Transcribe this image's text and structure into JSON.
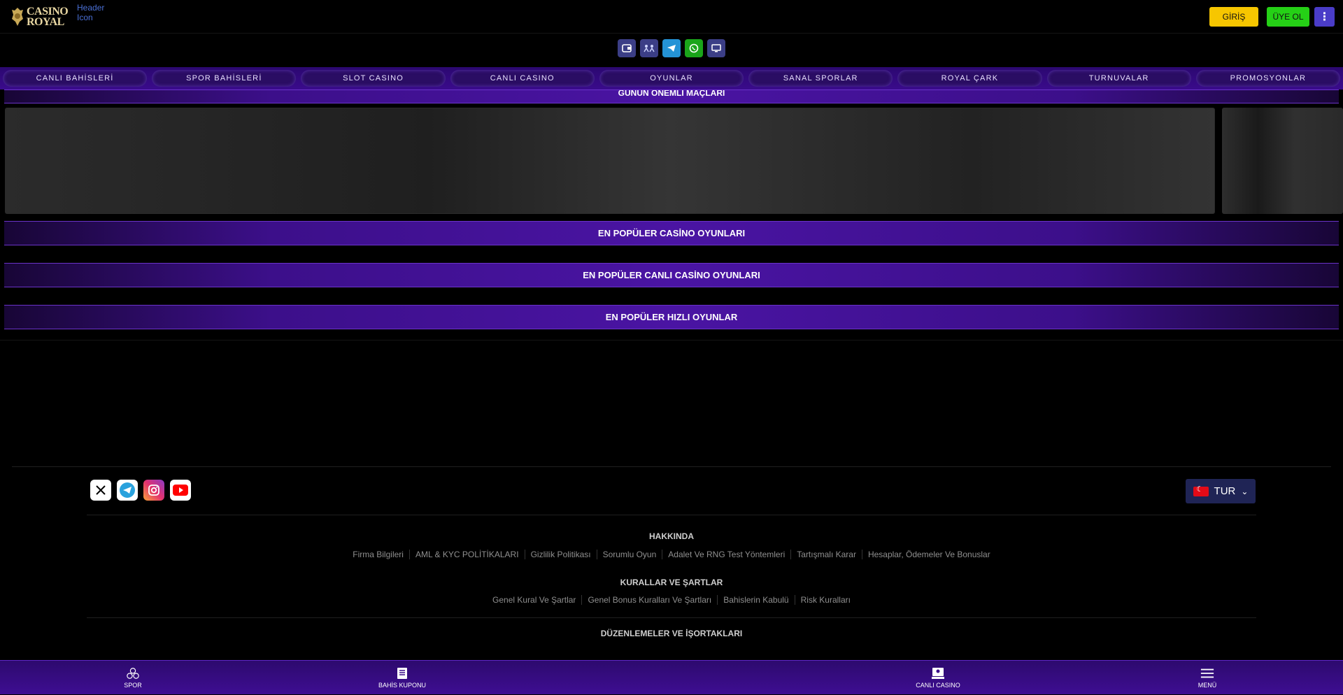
{
  "header": {
    "logo_line1": "CASINO",
    "logo_line2": "ROYAL",
    "broken_image_alt": "Header Icon",
    "login_label": "GİRİŞ",
    "register_label": "ÜYE OL",
    "more_icon": "kebab-menu-icon"
  },
  "quickbar": {
    "icons": [
      "wallet-icon",
      "users-icon",
      "telegram-icon",
      "whatsapp-icon",
      "tv-icon"
    ]
  },
  "nav": {
    "items": [
      "CANLI BAHİSLERİ",
      "SPOR BAHİSLERİ",
      "SLOT CASINO",
      "CANLI CASINO",
      "OYUNLAR",
      "SANAL SPORLAR",
      "ROYAL ÇARK",
      "TURNUVALAR",
      "PROMOSYONLAR"
    ]
  },
  "sections": {
    "matches_title": "GÜNÜN ÖNEMLİ MAÇLARI",
    "popular_casino": "EN POPÜLER CASİNO OYUNLARI",
    "popular_live_casino": "EN POPÜLER CANLI CASİNO OYUNLARI",
    "popular_fast_games": "EN POPÜLER HIZLI OYUNLAR"
  },
  "footer": {
    "socials": [
      "x-icon",
      "telegram-icon",
      "instagram-icon",
      "youtube-icon"
    ],
    "language": "TUR",
    "about_title": "HAKKINDA",
    "about_links": [
      "Firma Bilgileri",
      "AML & KYC POLİTİKALARI",
      "Gizlilik Politikası",
      "Sorumlu Oyun",
      "Adalet Ve RNG Test Yöntemleri",
      "Tartışmalı Karar",
      "Hesaplar, Ödemeler Ve Bonuslar"
    ],
    "rules_title": "KURALLAR VE ŞARTLAR",
    "rules_links": [
      "Genel Kural Ve Şartlar",
      "Genel Bonus Kuralları Ve Şartları",
      "Bahislerin Kabulü",
      "Risk Kuralları"
    ],
    "regulations_title": "DÜZENLEMELER VE İŞORTAKLARI"
  },
  "bottom_bar": {
    "sport": "SPOR",
    "coupon": "BAHİS KUPONU",
    "live_casino": "CANLI CASINO",
    "menu": "MENÜ"
  },
  "colors": {
    "login": "#f7c600",
    "register": "#25d016",
    "accent_purple": "#3c0f8a"
  }
}
